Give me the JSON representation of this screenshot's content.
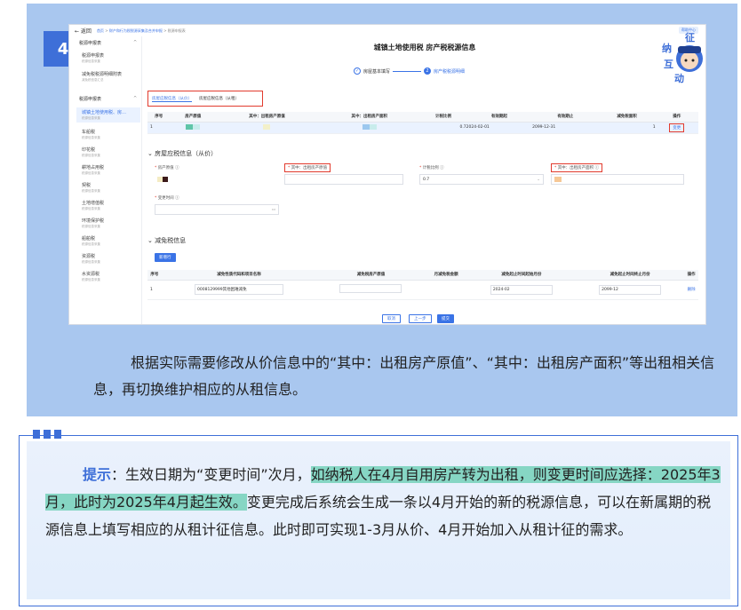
{
  "step_number": "4",
  "screenshot": {
    "back": "← 返回",
    "breadcrumb": [
      "首页",
      "财产和行为税税源采集及合并申报",
      "税源申报表"
    ],
    "help_label": "帮助中心",
    "page_title": "城镇土地使用税 房产税税源信息",
    "steps": [
      {
        "num": "✓",
        "label": "房屋基本填写"
      },
      {
        "num": "2",
        "label": "房产税税源明细"
      }
    ],
    "sidebar": {
      "group1": "税源申报表",
      "items1": [
        {
          "label": "税源申报表",
          "sub": "税源信息采集"
        },
        {
          "label": "减免税税源明细附表",
          "sub": "减免税信息汇总"
        }
      ],
      "group2": "税源申报表",
      "items2": [
        {
          "label": "城镇土地使用税、房…",
          "sub": "税源信息采集"
        },
        {
          "label": "车船税",
          "sub": "税源信息采集"
        },
        {
          "label": "印花税",
          "sub": "税源信息采集"
        },
        {
          "label": "耕地占用税",
          "sub": "税源信息采集"
        },
        {
          "label": "契税",
          "sub": "税源信息采集"
        },
        {
          "label": "土地增值税",
          "sub": "税源信息采集"
        },
        {
          "label": "环境保护税",
          "sub": "税源信息采集"
        },
        {
          "label": "船舶税",
          "sub": "税源信息采集"
        },
        {
          "label": "资源税",
          "sub": "税源信息采集"
        },
        {
          "label": "水资源税",
          "sub": "税源信息采集"
        }
      ]
    },
    "subtabs": [
      "房屋应税信息（从价）",
      "房屋应税信息（从租）"
    ],
    "table1": {
      "headers": [
        "序号",
        "房产原值",
        "其中：出租房产原值",
        "其中：出租房产面积",
        "计税比例",
        "有效期起",
        "有效期止",
        "减免税面积",
        "操作"
      ],
      "row": {
        "idx": "1",
        "ratio": "0.7",
        "start": "2024-02-01",
        "end": "2099-12-31",
        "count": "1",
        "action": "变更"
      }
    },
    "section1": "房屋应税信息（从价）",
    "fields": {
      "orig_value_label": "房产原值",
      "rent_value_label": "其中：出租房产原值",
      "ratio_label": "计税比例",
      "ratio_value": "0.7",
      "rent_area_label": "其中：出租房产面积",
      "change_time_label": "变更时间"
    },
    "section2": "减免税信息",
    "add_button": "新增行",
    "table2": {
      "headers": [
        "序号",
        "减免性质代码和项目名称",
        "减免税房产原值",
        "月减免税金额",
        "减免起止时间起始月份",
        "减免起止时间终止月份",
        "操作"
      ],
      "row": {
        "idx": "1",
        "code": "0008129999其他困难减免",
        "start": "2024-02",
        "end": "2099-12",
        "action": "删除"
      }
    },
    "footer_buttons": [
      "取消",
      "上一步",
      "提交"
    ]
  },
  "mascot_text": "征纳互动",
  "top_text": "根据实际需要修改从价信息中的“其中：出租房产原值”、“其中：出租房产面积”等出租相关信息，再切换维护相应的从租信息。",
  "tip": {
    "label": "提示",
    "colon": "：",
    "part1": "生效日期为“变更时间”次月，",
    "highlight": "如纳税人在4月自用房产转为出租，则变更时间应选择：2025年3月，此时为2025年4月起生效。",
    "part2": "变更完成后系统会生成一条以4月开始的新的税源信息，可以在新属期的税源信息上填写相应的从租计征信息。此时即可实现1-3月从价、4月开始加入从租计征的需求。"
  }
}
